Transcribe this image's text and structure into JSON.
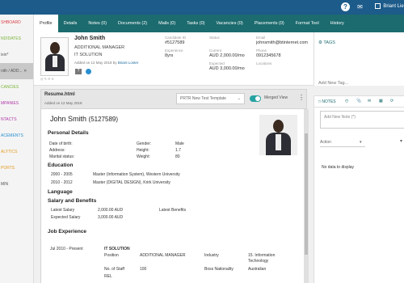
{
  "topbar": {
    "help_icon": "question-circle",
    "chat_icon": "chat-bubble",
    "user_label": "Briant Lie"
  },
  "sidebar": {
    "items": [
      {
        "label": "SHBOARD",
        "color": "#d9434a"
      },
      {
        "label": "NDIDATES",
        "color": "#7bb43a"
      },
      {
        "label": "ixin*",
        "color": "#555555"
      },
      {
        "label": "nith / ADD... ✕",
        "color": "#555555",
        "active": true
      },
      {
        "label": "CANCIES",
        "color": "#7bb43a"
      },
      {
        "label": "MPANIES",
        "color": "#b13aa8"
      },
      {
        "label": "NTACTS",
        "color": "#b13aa8"
      },
      {
        "label": "ACEMENTS",
        "color": "#2a8fd0"
      },
      {
        "label": "ALYTICS",
        "color": "#e39b1f"
      },
      {
        "label": "PORTS",
        "color": "#e39b1f"
      },
      {
        "label": "MIN",
        "color": "#555555"
      }
    ]
  },
  "tabs": [
    {
      "label": "Profile",
      "active": true
    },
    {
      "label": "Details"
    },
    {
      "label": "Notes (0)"
    },
    {
      "label": "Documents (2)"
    },
    {
      "label": "Mails (0)"
    },
    {
      "label": "Tasks (0)"
    },
    {
      "label": "Vacancies (0)"
    },
    {
      "label": "Placements (0)"
    },
    {
      "label": "Format Tool"
    },
    {
      "label": "History"
    }
  ],
  "profile": {
    "name": "John Smith",
    "title": "ADDITIONAL MANAGER",
    "company": "IT SOLUTION",
    "added_prefix": "Added on 12 May 2018 by",
    "added_by": "Briant Loster",
    "photo_controls": "◎ ✎ ⟳ ✕",
    "badge": "?",
    "fields": {
      "candidate_id_label": "Candidate ID",
      "candidate_id": "#5127589",
      "experience_label": "Experience",
      "experience": "8yrs",
      "status_label": "Status",
      "current_label": "Current",
      "current": "AUD 2,000.00/mo",
      "expected_label": "Expected",
      "expected": "AUD 3,000.00/mo",
      "email_label": "Email",
      "email": "johnsmith@btinternet.com",
      "phone_label": "Phone",
      "phone": "0912345678",
      "locations_label": "Locations"
    }
  },
  "tags": {
    "header": "TAGS",
    "add_placeholder": "Add New Tag..."
  },
  "resume_bar": {
    "file": "Resume.html",
    "added": "Added on 12 May 2018",
    "template": "PRTR New Test Template",
    "merged_view": "Merged View"
  },
  "resume": {
    "name": "John Smith",
    "id": "(5127589)",
    "personal_details": "Personal Details",
    "dob_label": "Date of birth:",
    "address_label": "Address:",
    "marital_label": "Marital status:",
    "gender_label": "Gender:",
    "gender": "Male",
    "height_label": "Height:",
    "height": "1.7",
    "weight_label": "Weight:",
    "weight": "80",
    "education": "Education",
    "edu1_years": "2000 - 2005",
    "edu1_degree": "Master (Information System), Western University",
    "edu2_years": "2010 - 2012",
    "edu2_degree": "Master (DIGITAL DESIGN), Krirk University",
    "language": "Language",
    "salary_benefits": "Salary and Benefits",
    "latest_salary_label": "Latest Salary",
    "latest_salary": "2,000.00 AUD",
    "expected_salary_label": "Expected Salary",
    "expected_salary": "3,000.00 AUD",
    "latest_benefits_label": "Latest Benefits",
    "job_experience": "Job Experience",
    "job_period": "Jul 2010 - Present",
    "job_company": "IT SOLUTION",
    "position_label": "Position",
    "position": "ADDITIONAL MANAGER",
    "industry_label": "Industry",
    "industry": "15. Information Technology",
    "staff_label": "No. of Staff",
    "staff": "100",
    "boss_label": "Boss Nationality",
    "boss": "Australian",
    "ref_label": "REL"
  },
  "notes": {
    "tab_label": "NOTES",
    "input_placeholder": "Add New Note (*)",
    "action_placeholder": "Action",
    "no_data": "No data to display"
  }
}
